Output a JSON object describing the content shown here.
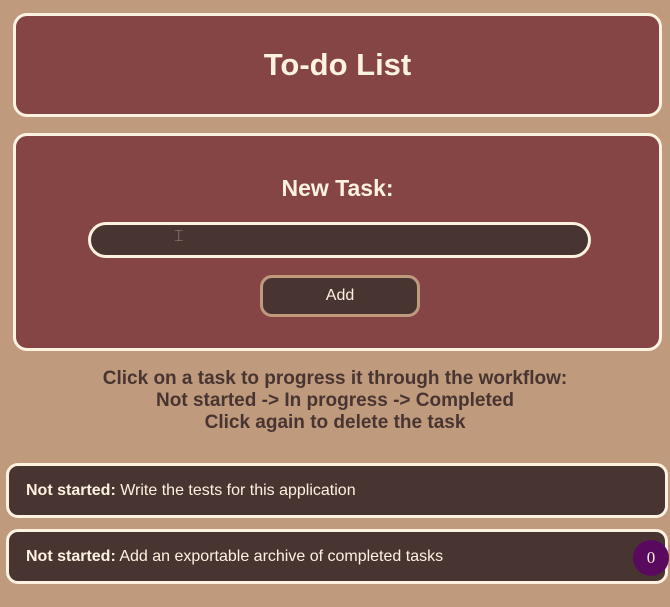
{
  "header": {
    "title": "To-do List"
  },
  "form": {
    "label": "New Task:",
    "input_value": "",
    "input_placeholder": "",
    "add_label": "Add"
  },
  "instructions": {
    "line1": "Click on a task to progress it through the workflow:",
    "line2": "Not started -> In progress -> Completed",
    "line3": "Click again to delete the task"
  },
  "tasks": [
    {
      "status": "Not started:",
      "text": "Write the tests for this application"
    },
    {
      "status": "Not started:",
      "text": "Add an exportable archive of completed tasks"
    }
  ],
  "counter": {
    "value": "0"
  },
  "colors": {
    "background": "#c09a7c",
    "panel": "#864545",
    "task_bg": "#483532",
    "border": "#fdf1e0",
    "counter_bg": "#5a0a5e"
  }
}
